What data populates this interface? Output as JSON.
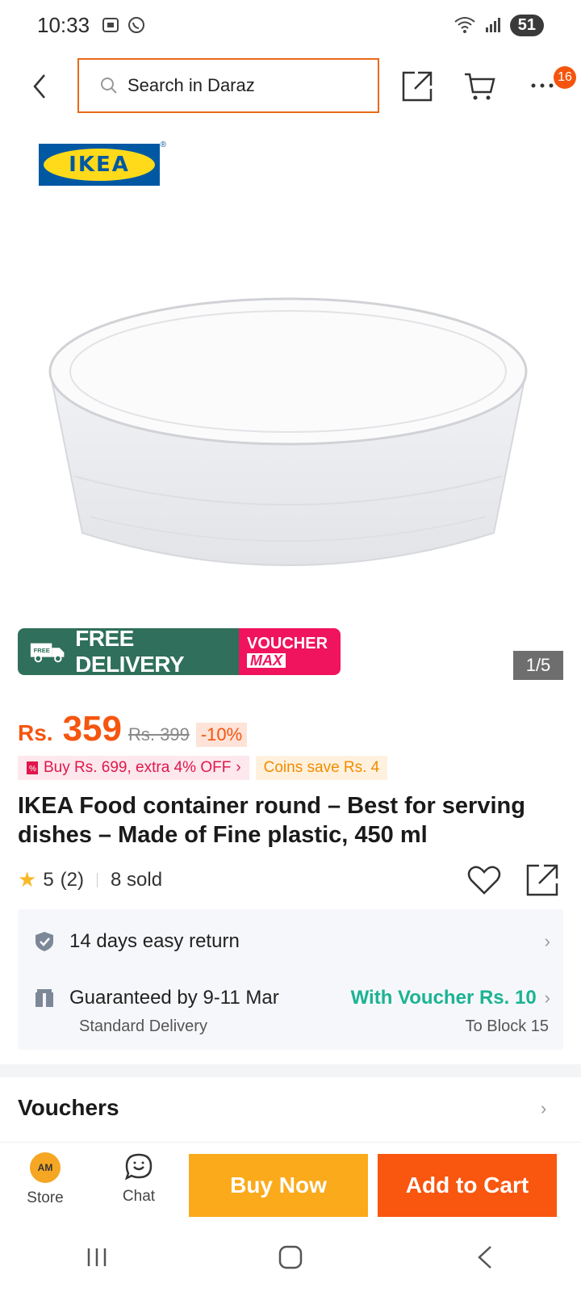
{
  "status_bar": {
    "time": "10:33",
    "battery": "51",
    "icons_left": [
      "screenshot-icon",
      "whatsapp-icon"
    ],
    "icons_right": [
      "wifi-icon",
      "signal-icon",
      "battery-icon"
    ]
  },
  "top_nav": {
    "search_placeholder": "Search in Daraz",
    "badge_count": "16"
  },
  "gallery": {
    "logo_text": "IKEA",
    "promo_free_label": "FREE DELIVERY",
    "promo_free_small": "FREE",
    "promo_voucher_line1": "VOUCHER",
    "promo_voucher_line2": "MAX",
    "page_indicator": "1/5"
  },
  "price": {
    "currency": "Rs.",
    "value": "359",
    "original": "Rs. 399",
    "discount": "-10%"
  },
  "promo_tags": {
    "pink": "Buy Rs. 699, extra 4% OFF",
    "orange": "Coins save Rs. 4"
  },
  "product": {
    "title": "IKEA Food container round – Best for serving dishes – Made of Fine plastic, 450 ml"
  },
  "rating": {
    "score": "5",
    "count": "(2)",
    "sold": "8 sold"
  },
  "service": {
    "return_label": "14 days easy return",
    "delivery_label": "Guaranteed by 9-11 Mar",
    "voucher_label": "With Voucher Rs. 10",
    "delivery_type": "Standard Delivery",
    "delivery_to": "To Block 15"
  },
  "vouchers": {
    "title": "Vouchers"
  },
  "action_bar": {
    "store_label": "Store",
    "chat_label": "Chat",
    "buy_now": "Buy Now",
    "add_to_cart": "Add to Cart",
    "store_logo_text": "AM"
  },
  "colors": {
    "accent_orange": "#f5550f",
    "buy_now": "#fbaa1b",
    "add_to_cart": "#f9560f",
    "free_delivery_green": "#2f6f5b",
    "voucher_pink": "#f0135e",
    "voucher_green": "#1bb394"
  }
}
